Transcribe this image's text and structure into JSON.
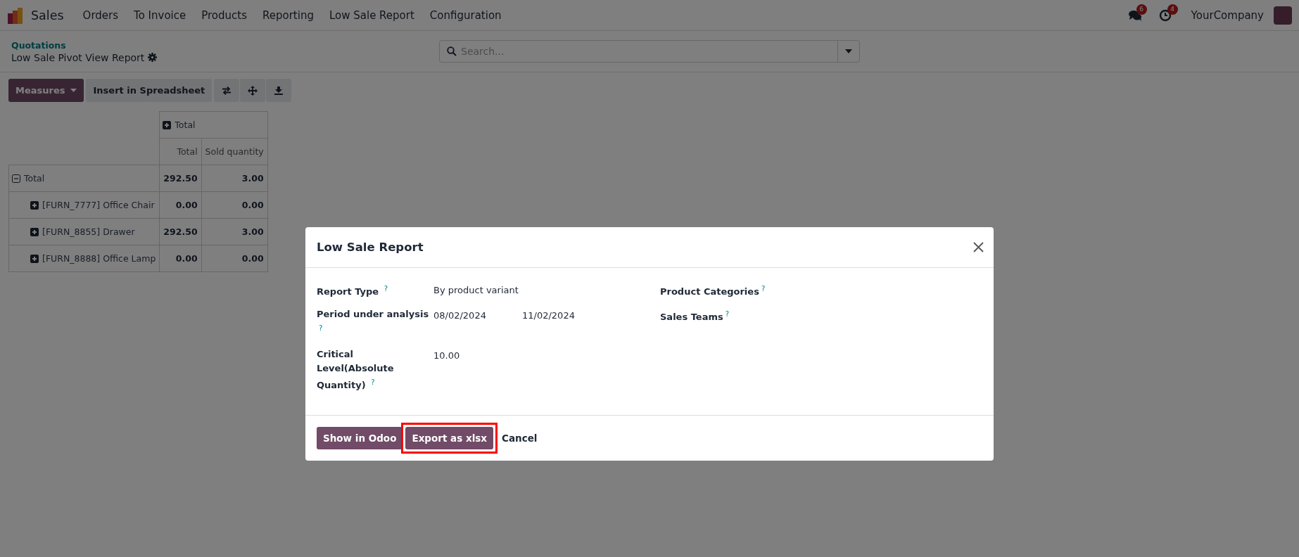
{
  "navbar": {
    "app": "Sales",
    "menu": [
      "Orders",
      "To Invoice",
      "Products",
      "Reporting",
      "Low Sale Report",
      "Configuration"
    ],
    "messages_count": "6",
    "activities_count": "4",
    "company": "YourCompany"
  },
  "breadcrumb": {
    "parent": "Quotations",
    "current": "Low Sale Pivot View Report"
  },
  "search": {
    "placeholder": "Search..."
  },
  "toolbar": {
    "measures": "Measures",
    "insert": "Insert in Spreadsheet"
  },
  "pivot": {
    "column_header": "Total",
    "column_expanded": false,
    "measures": [
      "Total",
      "Sold quantity"
    ],
    "rows": [
      {
        "label": "Total",
        "expanded": true,
        "values": [
          "292.50",
          "3.00"
        ],
        "children": [
          {
            "label": "[FURN_7777] Office Chair",
            "expanded": false,
            "values": [
              "0.00",
              "0.00"
            ]
          },
          {
            "label": "[FURN_8855] Drawer",
            "expanded": false,
            "values": [
              "292.50",
              "3.00"
            ]
          },
          {
            "label": "[FURN_8888] Office Lamp",
            "expanded": false,
            "values": [
              "0.00",
              "0.00"
            ]
          }
        ]
      }
    ]
  },
  "dialog": {
    "title": "Low Sale Report",
    "left_fields": [
      {
        "label": "Report Type",
        "help": "?",
        "values": [
          "By product variant"
        ]
      },
      {
        "label": "Period under analysis",
        "help": "?",
        "values": [
          "08/02/2024",
          "11/02/2024"
        ]
      },
      {
        "label": "Critical Level(Absolute Quantity)",
        "help": "?",
        "values": [
          "10.00"
        ]
      }
    ],
    "right_fields": [
      {
        "label": "Product Categories",
        "help": "?"
      },
      {
        "label": "Sales Teams",
        "help": "?"
      }
    ],
    "buttons": [
      {
        "label": "Show in Odoo",
        "kind": "primary",
        "highlighted": false
      },
      {
        "label": "Export as xlsx",
        "kind": "primary",
        "highlighted": true
      },
      {
        "label": "Cancel",
        "kind": "link",
        "highlighted": false
      }
    ]
  }
}
